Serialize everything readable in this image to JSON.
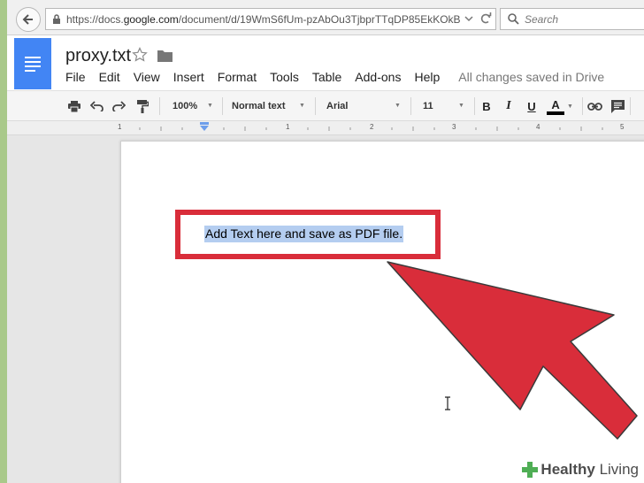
{
  "browser": {
    "url_prefix": "https://docs.",
    "url_host": "google.com",
    "url_rest": "/document/d/19WmS6fUm-pzAbOu3TjbprTTqDP85EkKOkB",
    "search_placeholder": "Search"
  },
  "doc": {
    "title": "proxy.txt",
    "menu": [
      "File",
      "Edit",
      "View",
      "Insert",
      "Format",
      "Tools",
      "Table",
      "Add-ons",
      "Help"
    ],
    "save_status": "All changes saved in Drive"
  },
  "toolbar": {
    "zoom": "100%",
    "style": "Normal text",
    "font": "Arial",
    "font_size": "11",
    "bold": "B",
    "italic": "I",
    "underline": "U",
    "text_color": "A"
  },
  "ruler": {
    "numbers": [
      "1",
      "1",
      "1",
      "2",
      "3",
      "4",
      "5"
    ]
  },
  "page": {
    "text": "Add Text here and save as PDF file."
  },
  "watermark": {
    "brand_bold": "Healthy",
    "brand_regular": "Living"
  },
  "colors": {
    "docs_blue": "#4285f4",
    "annotation_red": "#d92d3a",
    "selection": "#b4cdf0"
  }
}
